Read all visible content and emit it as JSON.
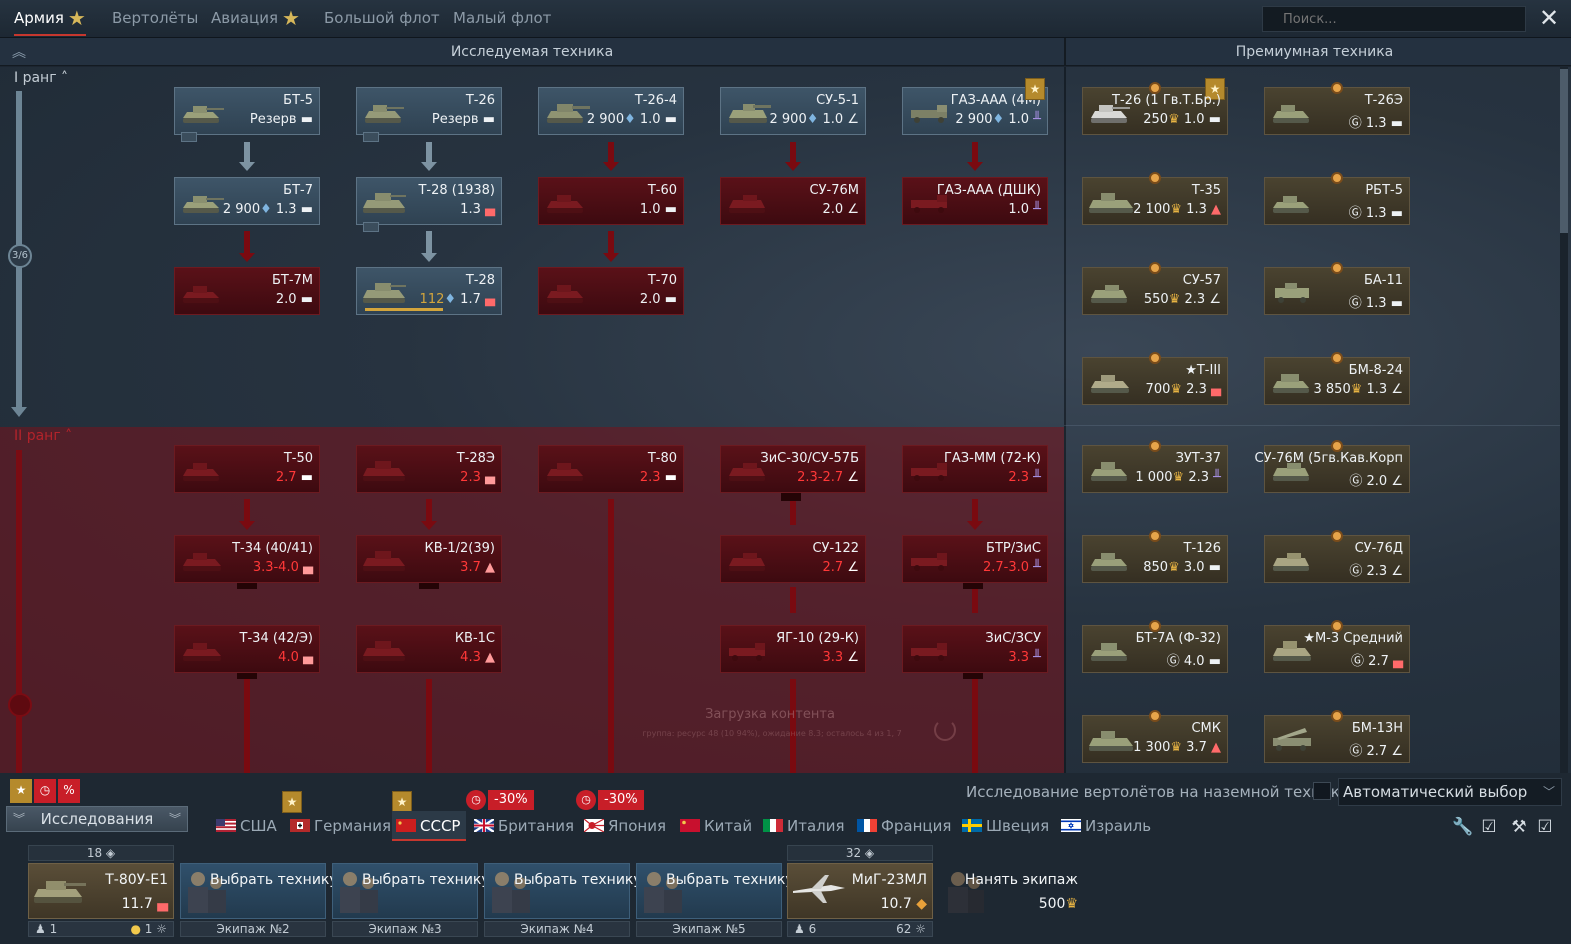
{
  "top_tabs": [
    {
      "label": "Армия",
      "star": true,
      "active": true
    },
    {
      "label": "Вертолёты"
    },
    {
      "label": "Авиация",
      "star": true
    },
    {
      "label": "Большой флот"
    },
    {
      "label": "Малый флот"
    }
  ],
  "search": {
    "placeholder": "Поиск..."
  },
  "sections": {
    "research": "Исследуемая техника",
    "premium": "Премиумная техника"
  },
  "ranks": {
    "rank1": "I ранг",
    "rank2": "II ранг",
    "rank1_progress": "3/6"
  },
  "tree": {
    "rank1": [
      {
        "name": "БТ-5",
        "stat": "Резерв"
      },
      {
        "name": "Т-26",
        "stat": "Резерв"
      },
      {
        "name": "Т-26-4",
        "cost": "2 900",
        "br": "1.0"
      },
      {
        "name": "СУ-5-1",
        "cost": "2 900",
        "br": "1.0"
      },
      {
        "name": "ГАЗ-ААА (4М)",
        "cost": "2 900",
        "br": "1.0"
      },
      {
        "name": "БТ-7",
        "cost": "2 900",
        "br": "1.3"
      },
      {
        "name": "Т-28 (1938)",
        "br": "1.3"
      },
      {
        "name": "Т-60",
        "br": "1.0"
      },
      {
        "name": "СУ-76М",
        "br": "2.0"
      },
      {
        "name": "ГАЗ-ААА (ДШК)",
        "br": "1.0"
      },
      {
        "name": "БТ-7М",
        "br": "2.0"
      },
      {
        "name": "Т-28",
        "cost": "112",
        "br": "1.7",
        "progress": 0.6
      },
      {
        "name": "Т-70",
        "br": "2.0"
      }
    ],
    "rank2": [
      {
        "name": "Т-50",
        "br": "2.7"
      },
      {
        "name": "Т-28Э",
        "br": "2.3"
      },
      {
        "name": "Т-80",
        "br": "2.3"
      },
      {
        "name": "ЗиС-30/СУ-57Б",
        "br": "2.3-2.7"
      },
      {
        "name": "ГАЗ-ММ (72-К)",
        "br": "2.3"
      },
      {
        "name": "Т-34 (40/41)",
        "br": "3.3-4.0"
      },
      {
        "name": "КВ-1/2(39)",
        "br": "3.7"
      },
      {
        "name": "СУ-122",
        "br": "2.7"
      },
      {
        "name": "БТР/ЗиС",
        "br": "2.7-3.0"
      },
      {
        "name": "Т-34 (42/Э)",
        "br": "4.0"
      },
      {
        "name": "КВ-1С",
        "br": "4.3"
      },
      {
        "name": "ЯГ-10 (29-К)",
        "br": "3.3"
      },
      {
        "name": "ЗиС/ЗСУ",
        "br": "3.3"
      }
    ]
  },
  "premium": [
    {
      "name": "Т-26 (1 Гв.Т.Бр.)",
      "stat": "250",
      "br": "1.0"
    },
    {
      "name": "Т-26Э",
      "br": "1.3"
    },
    {
      "name": "Т-35",
      "stat": "2 100",
      "br": "1.3"
    },
    {
      "name": "РБТ-5",
      "br": "1.3"
    },
    {
      "name": "СУ-57",
      "stat": "550",
      "br": "2.3"
    },
    {
      "name": "БА-11",
      "br": "1.3"
    },
    {
      "name": "★Т-III",
      "stat": "700",
      "br": "2.3"
    },
    {
      "name": "БМ-8-24",
      "stat": "3 850",
      "br": "1.3"
    },
    {
      "name": "ЗУТ-37",
      "stat": "1 000",
      "br": "2.3"
    },
    {
      "name": "СУ-76М (5гв.Кав.Корп",
      "br": "2.0"
    },
    {
      "name": "Т-126",
      "stat": "850",
      "br": "3.0"
    },
    {
      "name": "СУ-76Д",
      "br": "2.3"
    },
    {
      "name": "БТ-7А (Ф-32)",
      "br": "4.0"
    },
    {
      "name": "★М-3 Средний",
      "br": "2.7"
    },
    {
      "name": "СМК",
      "stat": "1 300",
      "br": "3.7"
    },
    {
      "name": "БМ-13Н",
      "br": "2.7"
    }
  ],
  "loading": {
    "text": "Загрузка контента",
    "sub": "группа: ресурс 48 (10 94%), ожидание 8.3; осталось 4 из 1, 7"
  },
  "helicopter_research": {
    "label": "Исследование вертолётов на наземной технике"
  },
  "auto_select": {
    "value": "Автоматический выбор"
  },
  "research_button": {
    "label": "Исследования"
  },
  "nations": [
    {
      "label": "США"
    },
    {
      "label": "Германия"
    },
    {
      "label": "СССР",
      "active": true
    },
    {
      "label": "Британия"
    },
    {
      "label": "Япония"
    },
    {
      "label": "Китай"
    },
    {
      "label": "Италия"
    },
    {
      "label": "Франция"
    },
    {
      "label": "Швеция"
    },
    {
      "label": "Израиль"
    }
  ],
  "discounts": {
    "britain": "-30%",
    "japan": "-30%"
  },
  "crew_slots": [
    {
      "title": "Т-80У-Е1",
      "value": "11.7",
      "head": "18",
      "foot_left": "1",
      "foot_right": "1"
    },
    {
      "title": "Выбрать технику",
      "foot": "Экипаж №2"
    },
    {
      "title": "Выбрать технику",
      "foot": "Экипаж №3"
    },
    {
      "title": "Выбрать технику",
      "foot": "Экипаж №4"
    },
    {
      "title": "Выбрать технику",
      "foot": "Экипаж №5"
    },
    {
      "title": "МиГ-23МЛ",
      "value": "10.7",
      "head": "32",
      "foot_left": "6",
      "foot_right": "62"
    },
    {
      "title": "Нанять экипаж",
      "value": "500"
    }
  ],
  "colors": {
    "accent_red": "#c6372e",
    "gold": "#d6b75a",
    "locked_text": "#ff3838"
  }
}
